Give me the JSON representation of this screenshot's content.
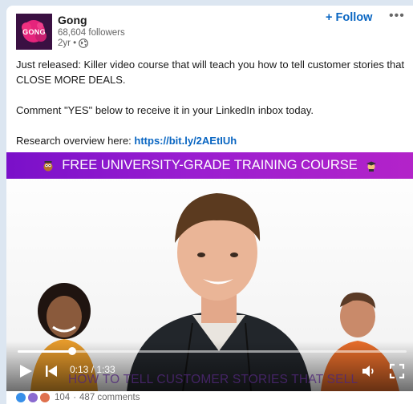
{
  "author": {
    "name": "Gong",
    "logo_text": "GONG",
    "followers": "68,604 followers",
    "time": "2yr •",
    "visibility_icon": "globe-icon"
  },
  "actions": {
    "follow_label": "+ Follow",
    "more_label": "•••"
  },
  "post": {
    "line1": "Just released: Killer video course that will teach you how to tell customer stories that CLOSE MORE DEALS.",
    "line2": "Comment \"YES\" below to receive it in your LinkedIn inbox today.",
    "line3_prefix": "Research overview here: ",
    "link": "https://bit.ly/2AEtIUh"
  },
  "video": {
    "banner_text": "FREE UNIVERSITY-GRADE TRAINING COURSE",
    "current_time": "0:13",
    "duration": "1:33",
    "time_readout": "0:13 / 1:33",
    "progress": 0.14,
    "caption": "HOW TO TELL CUSTOMER STORIES THAT SELL"
  },
  "social": {
    "reaction_count": "104",
    "comments": "487 comments",
    "separator": "·"
  },
  "colors": {
    "brand": "#3a1042",
    "link": "#0a66c2",
    "banner": "#9a1ed0"
  }
}
